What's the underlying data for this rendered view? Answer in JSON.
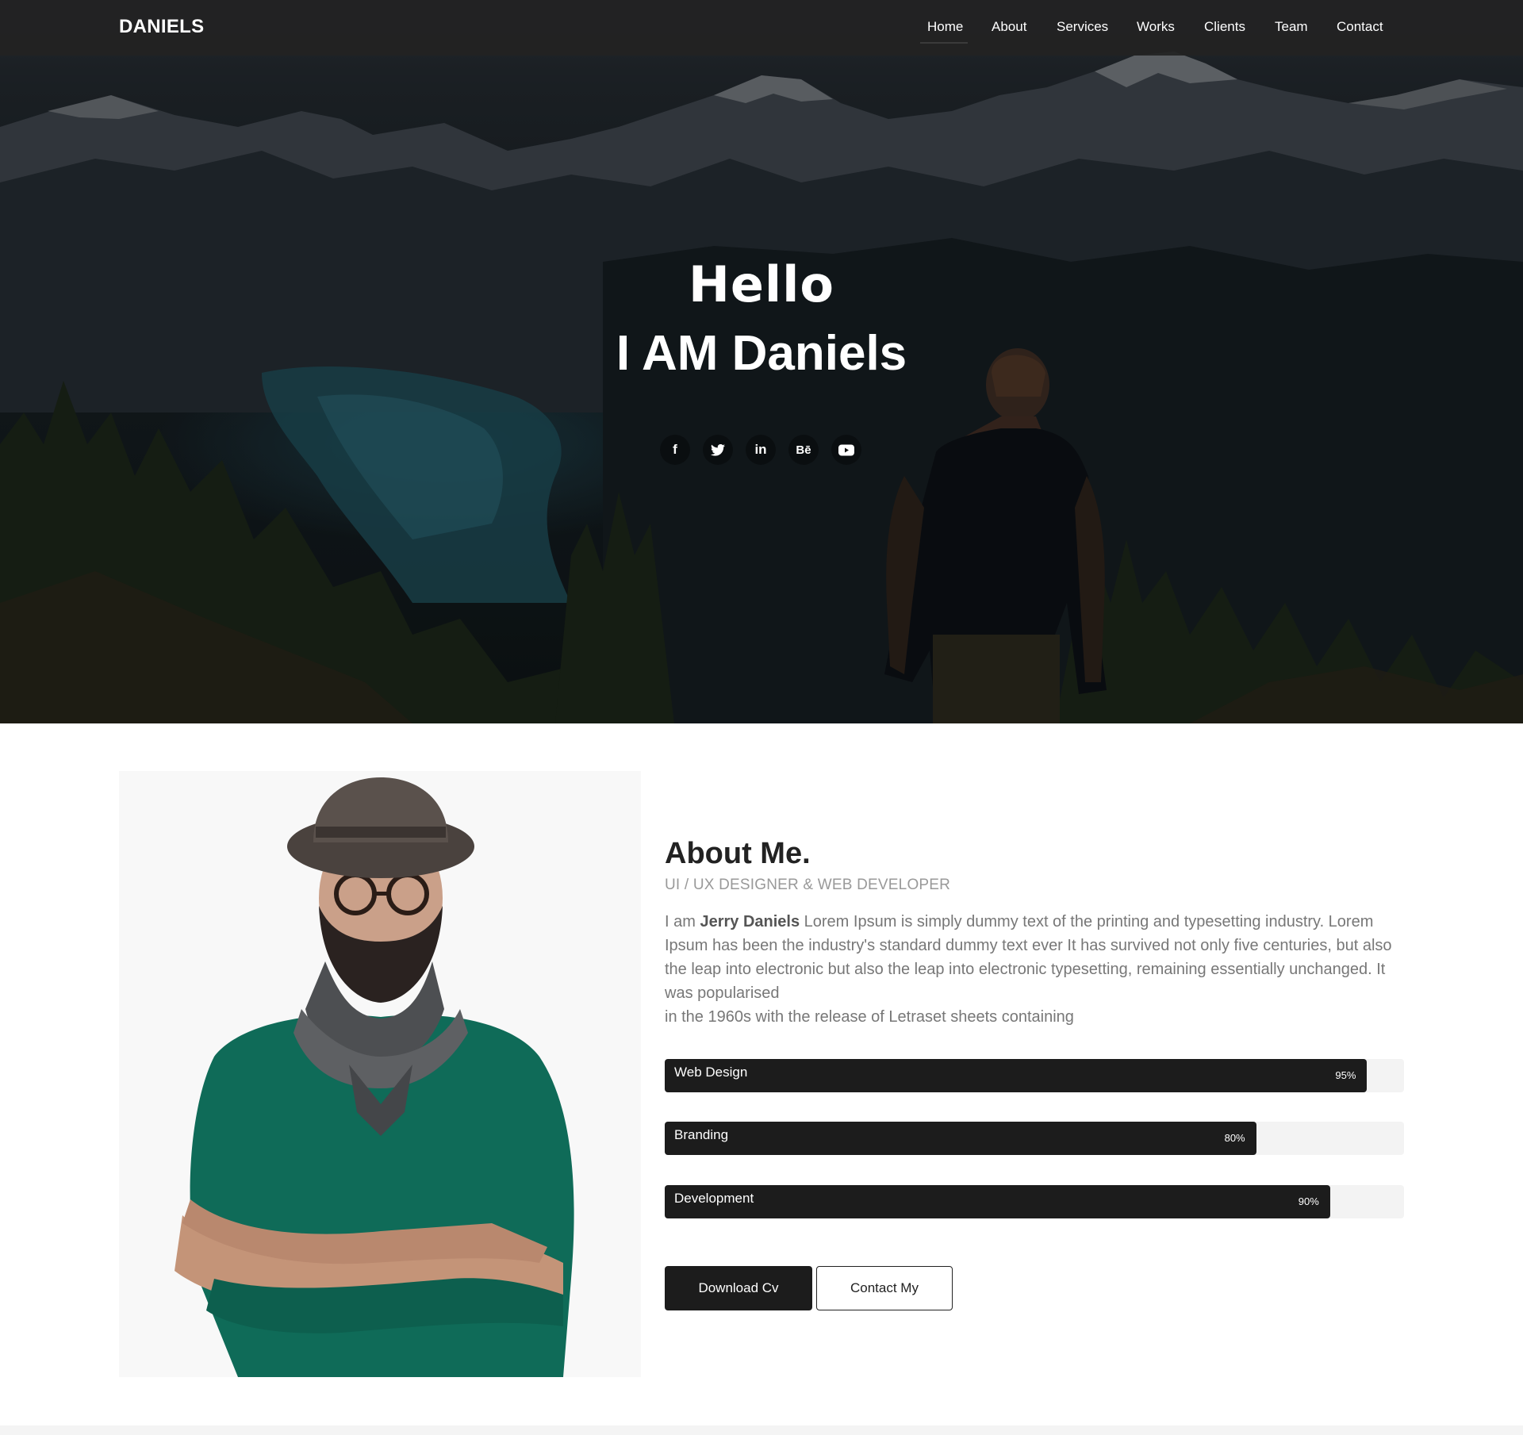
{
  "brand": "DANIELS",
  "nav": {
    "items": [
      "Home",
      "About",
      "Services",
      "Works",
      "Clients",
      "Team",
      "Contact"
    ],
    "active": "Home"
  },
  "hero": {
    "title": "Hello",
    "subtitle": "I AM Daniels",
    "socials": [
      {
        "icon": "facebook-icon",
        "glyph": "f"
      },
      {
        "icon": "twitter-icon",
        "glyph": "🐦"
      },
      {
        "icon": "linkedin-icon",
        "glyph": "in"
      },
      {
        "icon": "behance-icon",
        "glyph": "Bē"
      },
      {
        "icon": "youtube-icon",
        "glyph": "▶"
      }
    ]
  },
  "about": {
    "title": "About Me.",
    "role": "UI / UX DESIGNER & WEB DEVELOPER",
    "intro": "I am ",
    "name": "Jerry Daniels",
    "body": " Lorem Ipsum is simply dummy text of the printing and typesetting industry. Lorem Ipsum has been the industry's standard dummy text ever It has survived not only five centuries, but also the leap into electronic but also the leap into electronic typesetting, remaining essentially unchanged. It was popularised",
    "body2": "in the 1960s with the release of Letraset sheets containing"
  },
  "skills": [
    {
      "name": "Web Design",
      "percent": 95,
      "label": "95%"
    },
    {
      "name": "Branding",
      "percent": 80,
      "label": "80%"
    },
    {
      "name": "Development",
      "percent": 90,
      "label": "90%"
    }
  ],
  "buttons": {
    "download": "Download Cv",
    "contact": "Contact My"
  },
  "colors": {
    "dark": "#1c1c1c",
    "navbar": "#222222",
    "text_muted": "#777777",
    "track": "#f3f3f3",
    "sweater": "#0f6b58"
  }
}
